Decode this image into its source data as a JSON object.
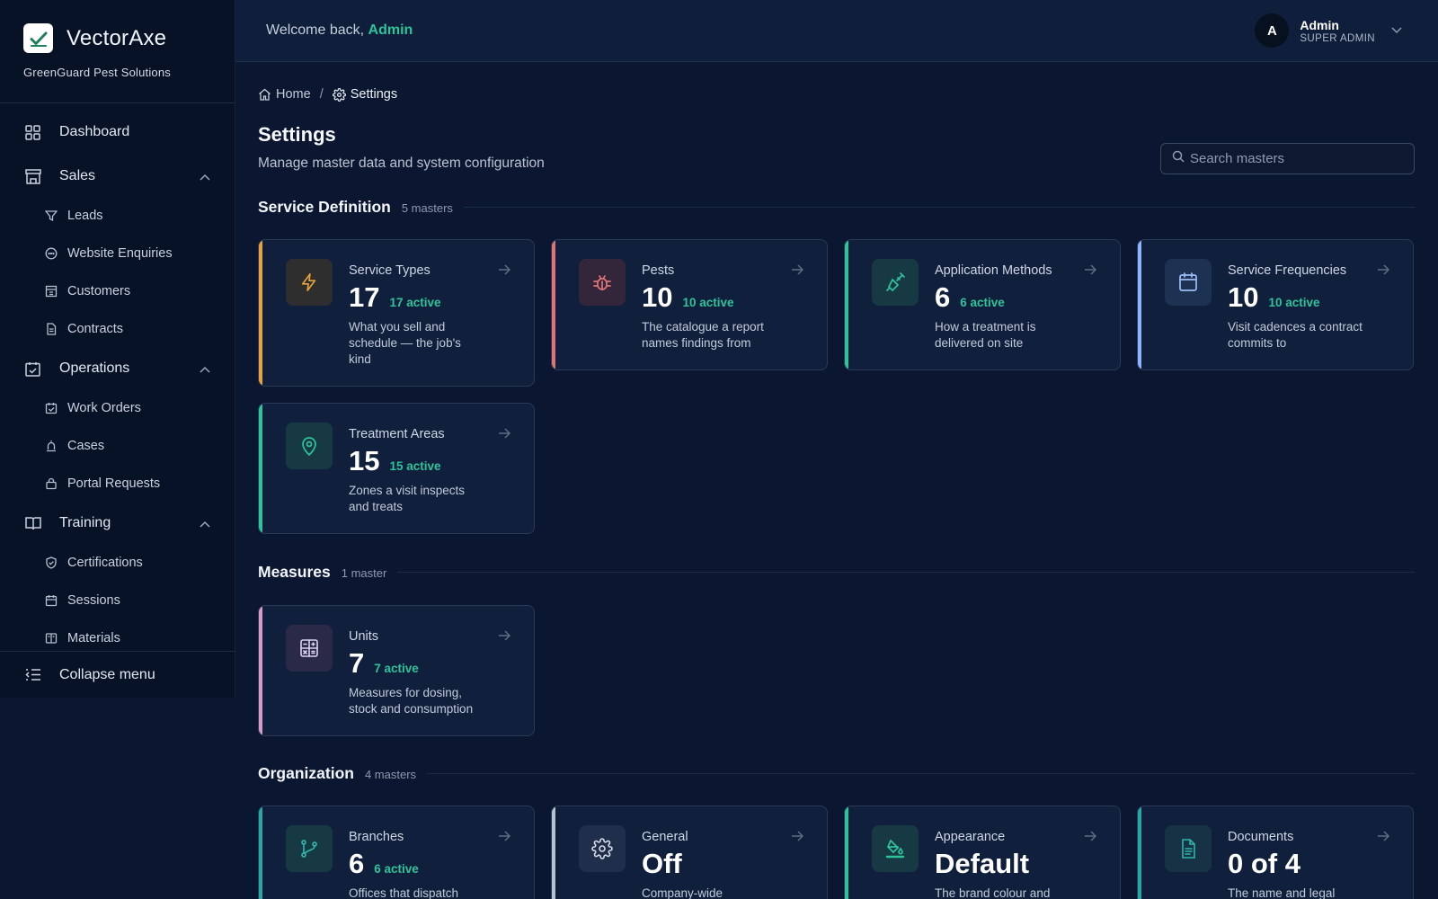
{
  "brand": {
    "name": "VectorAxe",
    "company": "GreenGuard Pest Solutions"
  },
  "sidebar": {
    "items": [
      {
        "label": "Dashboard",
        "icon": "grid-icon"
      },
      {
        "label": "Sales",
        "icon": "store-icon",
        "expanded": true,
        "children": [
          {
            "label": "Leads",
            "icon": "funnel-icon"
          },
          {
            "label": "Website Enquiries",
            "icon": "chat-icon"
          },
          {
            "label": "Customers",
            "icon": "building-icon"
          },
          {
            "label": "Contracts",
            "icon": "file-icon"
          }
        ]
      },
      {
        "label": "Operations",
        "icon": "calendar-check-icon",
        "expanded": true,
        "children": [
          {
            "label": "Work Orders",
            "icon": "calendar-check-icon"
          },
          {
            "label": "Cases",
            "icon": "siren-icon"
          },
          {
            "label": "Portal Requests",
            "icon": "inbox-icon"
          }
        ]
      },
      {
        "label": "Training",
        "icon": "book-icon",
        "expanded": true,
        "children": [
          {
            "label": "Certifications",
            "icon": "shield-check-icon"
          },
          {
            "label": "Sessions",
            "icon": "calendar-icon"
          },
          {
            "label": "Materials",
            "icon": "book-icon"
          }
        ]
      }
    ],
    "collapse_label": "Collapse menu"
  },
  "header": {
    "welcome_prefix": "Welcome back, ",
    "welcome_name": "Admin"
  },
  "user": {
    "initial": "A",
    "name": "Admin",
    "role": "SUPER ADMIN"
  },
  "breadcrumb": {
    "home": "Home",
    "current": "Settings",
    "separator": "/"
  },
  "page": {
    "title": "Settings",
    "subtitle": "Manage master data and system configuration"
  },
  "search": {
    "placeholder": "Search masters",
    "value": ""
  },
  "sections": [
    {
      "title": "Service Definition",
      "count": "5 masters",
      "cards": [
        {
          "name": "Service Types",
          "value": "17",
          "active": "17 active",
          "desc": "What you sell and schedule — the job's kind",
          "accent": "#e8a33d",
          "icon": "bolt-icon"
        },
        {
          "name": "Pests",
          "value": "10",
          "active": "10 active",
          "desc": "The catalogue a report names findings from",
          "accent": "#e07474",
          "icon": "bug-icon"
        },
        {
          "name": "Application Methods",
          "value": "6",
          "active": "6 active",
          "desc": "How a treatment is delivered on site",
          "accent": "#2fc39a",
          "icon": "syringe-icon"
        },
        {
          "name": "Service Frequencies",
          "value": "10",
          "active": "10 active",
          "desc": "Visit cadences a contract commits to",
          "accent": "#8fb4ff",
          "icon": "calendar-icon"
        },
        {
          "name": "Treatment Areas",
          "value": "15",
          "active": "15 active",
          "desc": "Zones a visit inspects and treats",
          "accent": "#2fc39a",
          "icon": "map-pin-icon"
        }
      ]
    },
    {
      "title": "Measures",
      "count": "1 master",
      "cards": [
        {
          "name": "Units",
          "value": "7",
          "active": "7 active",
          "desc": "Measures for dosing, stock and consumption",
          "accent": "#d79bc9",
          "icon": "calculator-icon"
        }
      ]
    },
    {
      "title": "Organization",
      "count": "4 masters",
      "cards": [
        {
          "name": "Branches",
          "value": "6",
          "active": "6 active",
          "desc": "Offices that dispatch",
          "accent": "#2aa6a0",
          "icon": "git-branch-icon"
        },
        {
          "name": "General",
          "value": "Off",
          "active": "",
          "desc": "Company-wide",
          "accent": "#b6c0cf",
          "icon": "gear-icon"
        },
        {
          "name": "Appearance",
          "value": "Default",
          "active": "",
          "desc": "The brand colour and",
          "accent": "#2fc39a",
          "icon": "paint-bucket-icon"
        },
        {
          "name": "Documents",
          "value": "0 of 4",
          "active": "",
          "desc": "The name and legal",
          "accent": "#2aa6a0",
          "icon": "document-icon"
        }
      ]
    }
  ]
}
